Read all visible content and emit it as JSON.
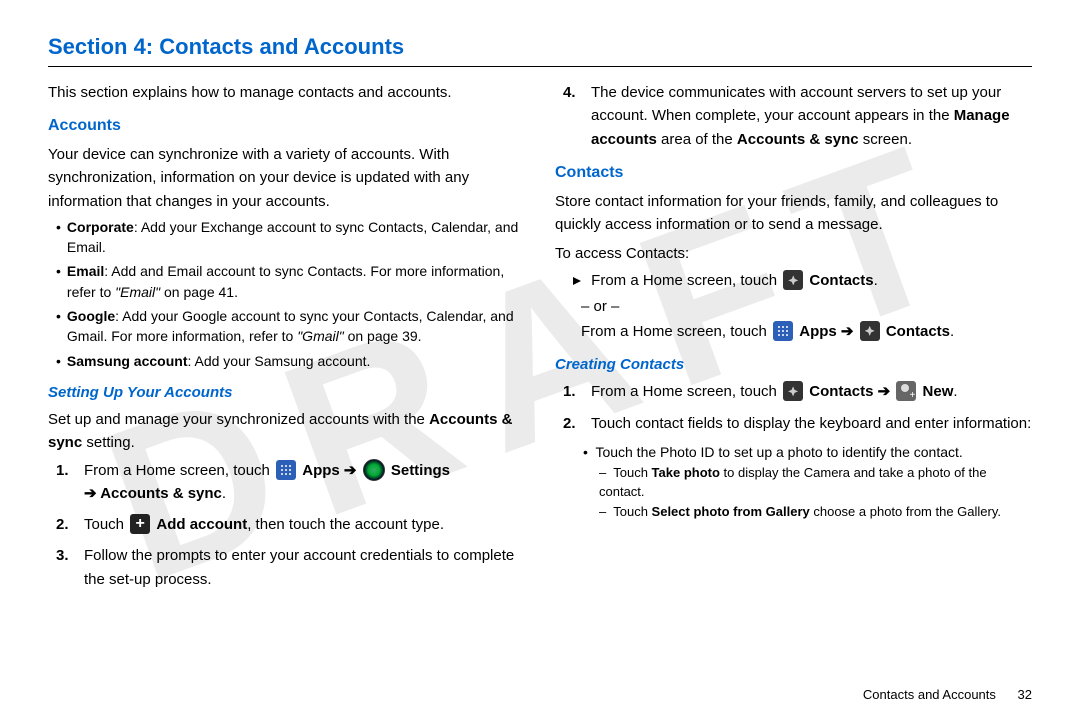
{
  "watermark": "DRAFT",
  "title": "Section 4: Contacts and Accounts",
  "intro": "This section explains how to manage contacts and accounts.",
  "accounts": {
    "heading": "Accounts",
    "para": "Your device can synchronize with a variety of accounts. With synchronization, information on your device is updated with any information that changes in your accounts.",
    "bullets": {
      "corp_b": "Corporate",
      "corp_t": ": Add your Exchange account to sync Contacts, Calendar, and Email.",
      "email_b": "Email",
      "email_t": ": Add and Email account to sync Contacts. For more information, refer to ",
      "email_ref": "\"Email\"",
      "email_pg": " on page 41.",
      "google_b": "Google",
      "google_t": ": Add your Google account to sync your Contacts, Calendar, and Gmail. For more information, refer to ",
      "google_ref": "\"Gmail\"",
      "google_pg": " on page 39.",
      "sams_b": "Samsung account",
      "sams_t": ": Add your Samsung account."
    }
  },
  "setup": {
    "heading": "Setting Up Your Accounts",
    "para_pre": "Set up and manage your synchronized accounts with the ",
    "para_b": "Accounts & sync",
    "para_post": " setting.",
    "step1_pre": "From a Home screen, touch ",
    "apps_label": "Apps",
    "settings_label": "Settings",
    "step1_line2_arrow": "➔",
    "step1_line2_b": "Accounts & sync",
    "step1_line2_post": ".",
    "step2_pre": "Touch ",
    "step2_b": "Add account",
    "step2_post": ", then touch the account type.",
    "step3": "Follow the prompts to enter your account credentials to complete the set-up process."
  },
  "right": {
    "step4_pre": "The device communicates with account servers to set up your account. When complete, your account appears in the ",
    "step4_b1": "Manage accounts",
    "step4_mid": " area of the ",
    "step4_b2": "Accounts & sync",
    "step4_post": " screen."
  },
  "contacts": {
    "heading": "Contacts",
    "para": "Store contact information for your friends, family, and colleagues to quickly access information or to send a message.",
    "access": "To access Contacts:",
    "from_home": "From a Home screen, touch ",
    "contacts_label": "Contacts",
    "or": "– or –",
    "apps_label": "Apps",
    "creating_heading": "Creating Contacts",
    "new_label": "New",
    "step2_pre": "Touch contact fields to display the keyboard and enter information:",
    "sub_bullet": "Touch the Photo ID to set up a photo to identify the contact.",
    "dash1_pre": "Touch ",
    "dash1_b": "Take photo",
    "dash1_post": " to display the Camera and take a photo of the contact.",
    "dash2_pre": "Touch ",
    "dash2_b": "Select photo from Gallery",
    "dash2_post": " choose a photo from the Gallery."
  },
  "footer": {
    "section": "Contacts and Accounts",
    "page": "32"
  },
  "nums": {
    "n1": "1.",
    "n2": "2.",
    "n3": "3.",
    "n4": "4."
  },
  "glyphs": {
    "arrow": "➔",
    "bullet": "•",
    "dash": "–",
    "plus": "+"
  }
}
